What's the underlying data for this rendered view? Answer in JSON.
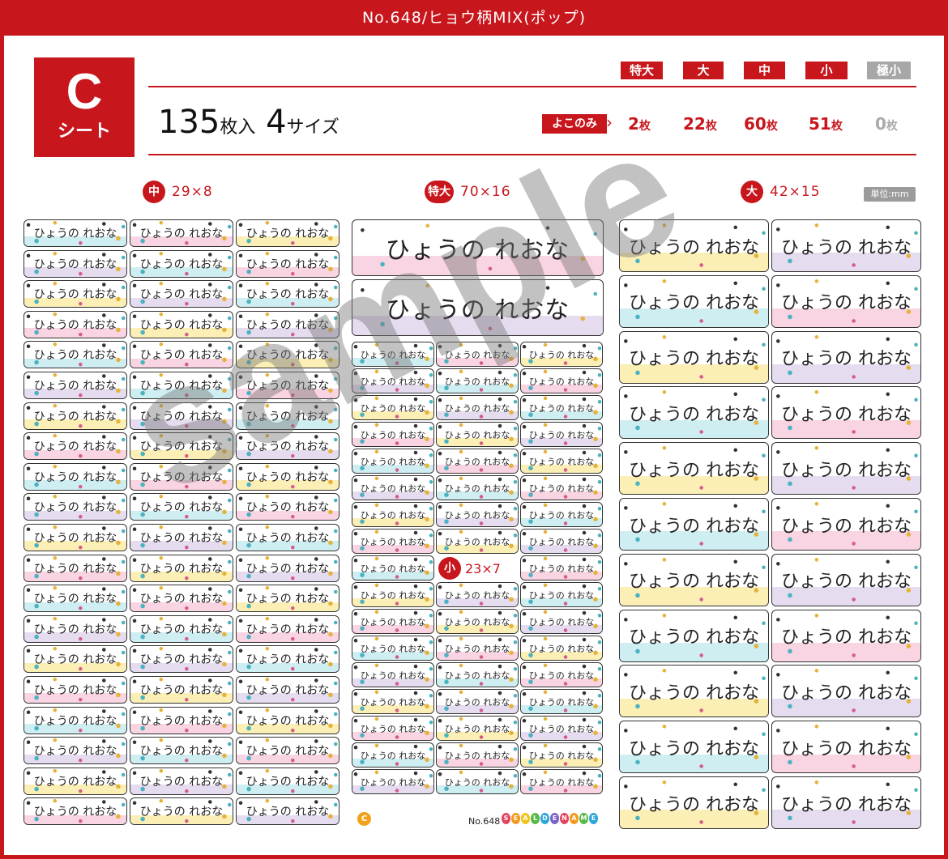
{
  "title": "No.648/ヒョウ柄MIX(ポップ)",
  "sheet": {
    "letter": "C",
    "word": "シート"
  },
  "count": {
    "number": "135",
    "unit": "枚入",
    "sizes_number": "4",
    "sizes_unit": "サイズ"
  },
  "size_headers": [
    {
      "label": "特大",
      "active": true
    },
    {
      "label": "大",
      "active": true
    },
    {
      "label": "中",
      "active": true
    },
    {
      "label": "小",
      "active": true
    },
    {
      "label": "極小",
      "active": false
    }
  ],
  "yoko_label": "よこのみ",
  "counts": [
    {
      "value": "2",
      "unit": "枚"
    },
    {
      "value": "22",
      "unit": "枚"
    },
    {
      "value": "60",
      "unit": "枚"
    },
    {
      "value": "51",
      "unit": "枚"
    },
    {
      "value": "0",
      "unit": "枚"
    }
  ],
  "sections": {
    "medium": {
      "badge": "中",
      "dims": "29×8"
    },
    "xlarge": {
      "badge": "特大",
      "dims": "70×16"
    },
    "large": {
      "badge": "大",
      "dims": "42×15"
    },
    "small": {
      "badge": "小",
      "dims": "23×7"
    }
  },
  "unit_note": "単位:mm",
  "label_text": "ひょうの れおな",
  "watermark": "sample",
  "footer": {
    "sheet_letter": "C",
    "code": "No.648",
    "brand": "SEALDENAME"
  },
  "colors": {
    "accent": "#c8161d",
    "band_blue": "#cfeef2",
    "band_pink": "#f9d4e2",
    "band_yellow": "#fbefb6",
    "band_lilac": "#e5dcf0"
  }
}
